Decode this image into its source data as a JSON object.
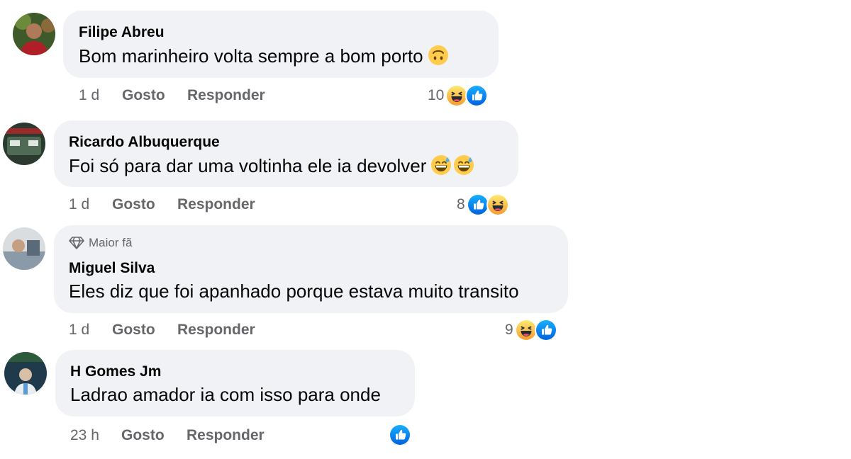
{
  "comments": [
    {
      "author": "Filipe Abreu",
      "text": "Bom marinheiro volta sempre a bom porto",
      "badge": "",
      "time": "1 d",
      "like_label": "Gosto",
      "reply_label": "Responder",
      "reaction_count": "10",
      "reactions": [
        "haha-icon",
        "like-icon"
      ],
      "inline_emojis": [
        "upside-down-face-icon"
      ]
    },
    {
      "author": "Ricardo Albuquerque",
      "text": "Foi só para dar uma voltinha ele ia devolver",
      "badge": "",
      "time": "1 d",
      "like_label": "Gosto",
      "reply_label": "Responder",
      "reaction_count": "8",
      "reactions": [
        "like-icon",
        "haha-icon"
      ],
      "inline_emojis": [
        "grinning-sweat-icon",
        "grinning-sweat-icon"
      ]
    },
    {
      "author": "Miguel Silva",
      "text": "Eles diz que foi apanhado porque estava muito transito",
      "badge": "Maior fã",
      "time": "1 d",
      "like_label": "Gosto",
      "reply_label": "Responder",
      "reaction_count": "9",
      "reactions": [
        "haha-icon",
        "like-icon"
      ],
      "inline_emojis": []
    },
    {
      "author": "H Gomes Jm",
      "text": "Ladrao amador ia com isso para onde",
      "badge": "",
      "time": "23 h",
      "like_label": "Gosto",
      "reply_label": "Responder",
      "reaction_count": "",
      "reactions": [
        "like-icon"
      ],
      "inline_emojis": []
    }
  ],
  "colors": {
    "bubble": "#f0f2f5",
    "secondary_text": "#65676b",
    "like_blue": "#1877f2",
    "haha_yellow": "#f7b125"
  }
}
